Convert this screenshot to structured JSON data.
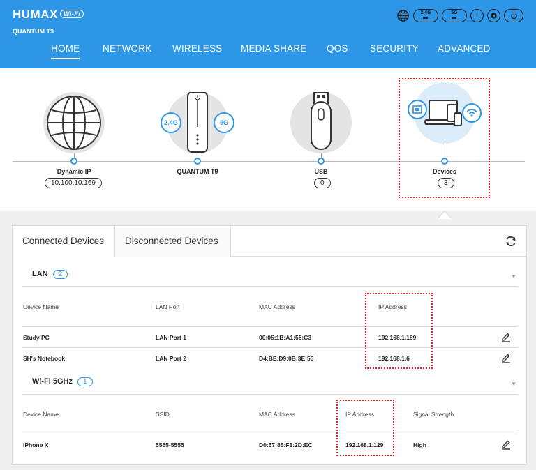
{
  "header": {
    "brand": "HUMAX",
    "brand_badge": "Wi-Fi",
    "model": "QUANTUM T9",
    "icons": {
      "globe": "globe-icon",
      "band_24": "2.4G",
      "band_5": "5G",
      "info": "i",
      "settings": "gear-icon",
      "power": "power-icon"
    },
    "nav": [
      {
        "label": "HOME",
        "active": true
      },
      {
        "label": "NETWORK"
      },
      {
        "label": "WIRELESS"
      },
      {
        "label": "MEDIA SHARE"
      },
      {
        "label": "QOS"
      },
      {
        "label": "SECURITY"
      },
      {
        "label": "ADVANCED"
      }
    ]
  },
  "topology": {
    "internet": {
      "label": "Dynamic IP",
      "value": "10.100.10.169"
    },
    "router": {
      "label": "QUANTUM T9",
      "band_24": "2.4G",
      "band_5": "5G"
    },
    "usb": {
      "label": "USB",
      "value": "0"
    },
    "devices": {
      "label": "Devices",
      "value": "3"
    }
  },
  "panel": {
    "tabs": [
      {
        "label": "Connected Devices",
        "active": true
      },
      {
        "label": "Disconnected Devices"
      }
    ],
    "lan": {
      "title": "LAN",
      "count": "2",
      "headers": [
        "Device Name",
        "LAN Port",
        "MAC Address",
        "IP Address"
      ],
      "rows": [
        {
          "name": "Study PC",
          "port": "LAN Port 1",
          "mac": "00:05:1B:A1:58:C3",
          "ip": "192.168.1.189"
        },
        {
          "name": "SH's Notebook",
          "port": "LAN Port 2",
          "mac": "D4:BE:D9:0B:3E:55",
          "ip": "192.168.1.6"
        }
      ]
    },
    "wifi5": {
      "title": "Wi-Fi 5GHz",
      "count": "1",
      "headers": [
        "Device Name",
        "SSID",
        "MAC Address",
        "IP Address",
        "Signal Strength"
      ],
      "rows": [
        {
          "name": "iPhone X",
          "ssid": "5555-5555",
          "mac": "D0:57:85:F1:2D:EC",
          "ip": "192.168.1.129",
          "signal": "High"
        }
      ]
    }
  },
  "colors": {
    "brand_blue": "#2d96e6",
    "highlight_red": "#e02020"
  }
}
